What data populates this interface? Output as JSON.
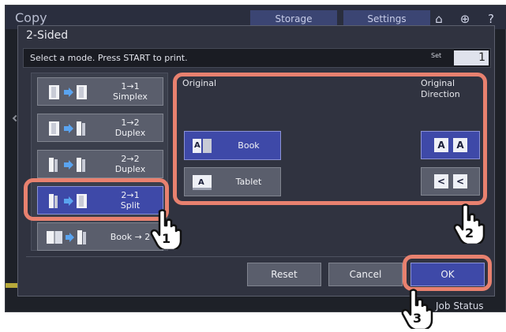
{
  "background": {
    "app_title": "Copy",
    "tabs": [
      "Storage",
      "Settings"
    ],
    "icons": [
      "home-icon",
      "globe-icon",
      "help-icon"
    ],
    "job_status": "Job Status"
  },
  "dialog": {
    "title": "2-Sided",
    "message": "Select a mode. Press START to print.",
    "set_label": "Set",
    "set_value": "1"
  },
  "modes": [
    {
      "line1": "1→1",
      "line2": "Simplex",
      "selected": false
    },
    {
      "line1": "1→2",
      "line2": "Duplex",
      "selected": false
    },
    {
      "line1": "2→2",
      "line2": "Duplex",
      "selected": false
    },
    {
      "line1": "2→1",
      "line2": "Split",
      "selected": true
    },
    {
      "line1": "Book → 2",
      "line2": "",
      "selected": false
    }
  ],
  "original": {
    "label": "Original",
    "options": [
      {
        "label": "Book",
        "selected": true
      },
      {
        "label": "Tablet",
        "selected": false
      }
    ]
  },
  "direction": {
    "label_line1": "Original",
    "label_line2": "Direction",
    "options": [
      {
        "glyph1": "A",
        "glyph2": "A",
        "selected": true
      },
      {
        "glyph1": "<",
        "glyph2": "<",
        "selected": false
      }
    ]
  },
  "actions": {
    "reset": "Reset",
    "cancel": "Cancel",
    "ok": "OK"
  },
  "callouts": [
    "1",
    "2",
    "3"
  ],
  "colors": {
    "accent": "#3e49a8",
    "callout": "#e8816f",
    "button": "#5a5e6c",
    "panel": "#303340"
  }
}
